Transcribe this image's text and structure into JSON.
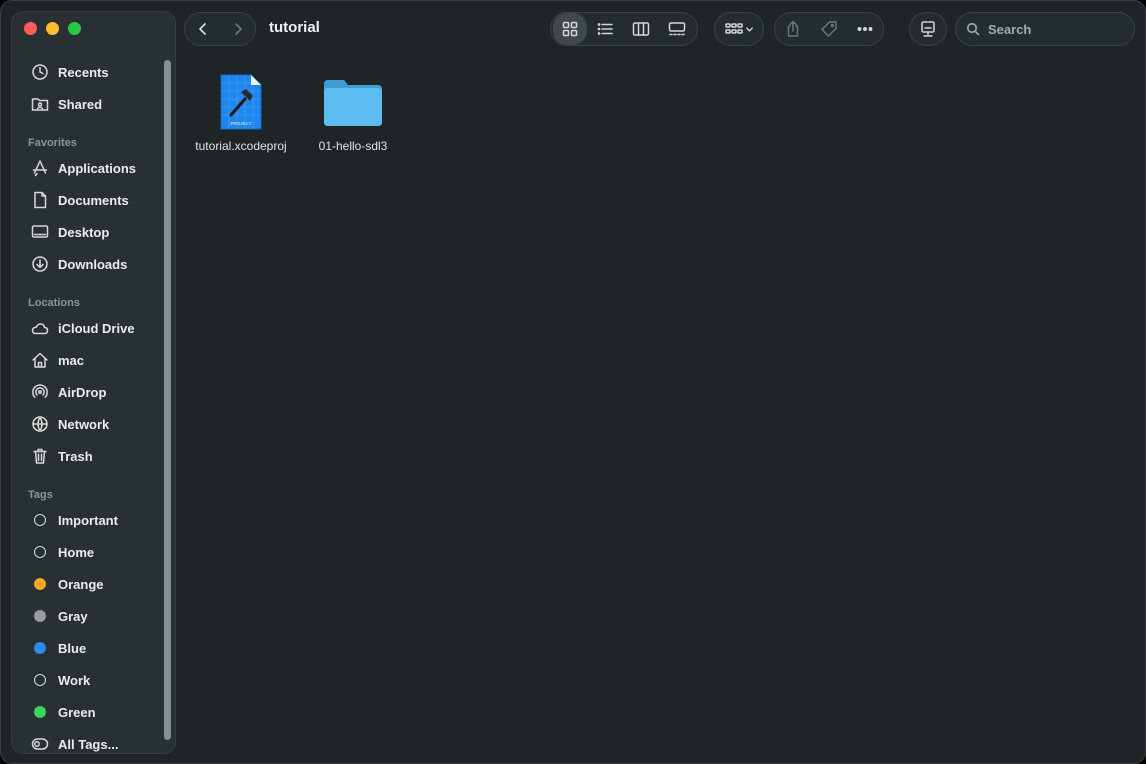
{
  "window": {
    "title": "tutorial"
  },
  "sidebar": {
    "sections": [
      {
        "items": [
          {
            "label": "Recents",
            "icon": "clock-icon"
          },
          {
            "label": "Shared",
            "icon": "shared-folder-icon"
          }
        ]
      },
      {
        "title": "Favorites",
        "items": [
          {
            "label": "Applications",
            "icon": "applications-icon"
          },
          {
            "label": "Documents",
            "icon": "document-icon"
          },
          {
            "label": "Desktop",
            "icon": "desktop-icon"
          },
          {
            "label": "Downloads",
            "icon": "download-icon"
          }
        ]
      },
      {
        "title": "Locations",
        "items": [
          {
            "label": "iCloud Drive",
            "icon": "cloud-icon"
          },
          {
            "label": "mac",
            "icon": "home-icon"
          },
          {
            "label": "AirDrop",
            "icon": "airdrop-icon"
          },
          {
            "label": "Network",
            "icon": "globe-icon"
          },
          {
            "label": "Trash",
            "icon": "trash-icon"
          }
        ]
      },
      {
        "title": "Tags",
        "items": [
          {
            "label": "Important",
            "tag_color": ""
          },
          {
            "label": "Home",
            "tag_color": ""
          },
          {
            "label": "Orange",
            "tag_color": "#f5a623"
          },
          {
            "label": "Gray",
            "tag_color": "#9b9b9b"
          },
          {
            "label": "Blue",
            "tag_color": "#2b8cf0"
          },
          {
            "label": "Work",
            "tag_color": ""
          },
          {
            "label": "Green",
            "tag_color": "#3ad35a"
          },
          {
            "label": "All Tags...",
            "icon": "all-tags-icon"
          }
        ]
      }
    ]
  },
  "toolbar": {
    "search_placeholder": "Search",
    "active_view": "icon"
  },
  "files": [
    {
      "name": "tutorial.xcodeproj",
      "kind": "xcode-project",
      "badge": "PROJECT"
    },
    {
      "name": "01-hello-sdl3",
      "kind": "folder"
    }
  ],
  "colors": {
    "close": "#ff5f57",
    "minimize": "#febc2e",
    "maximize": "#28c840",
    "folder": "#4fb3ea"
  }
}
